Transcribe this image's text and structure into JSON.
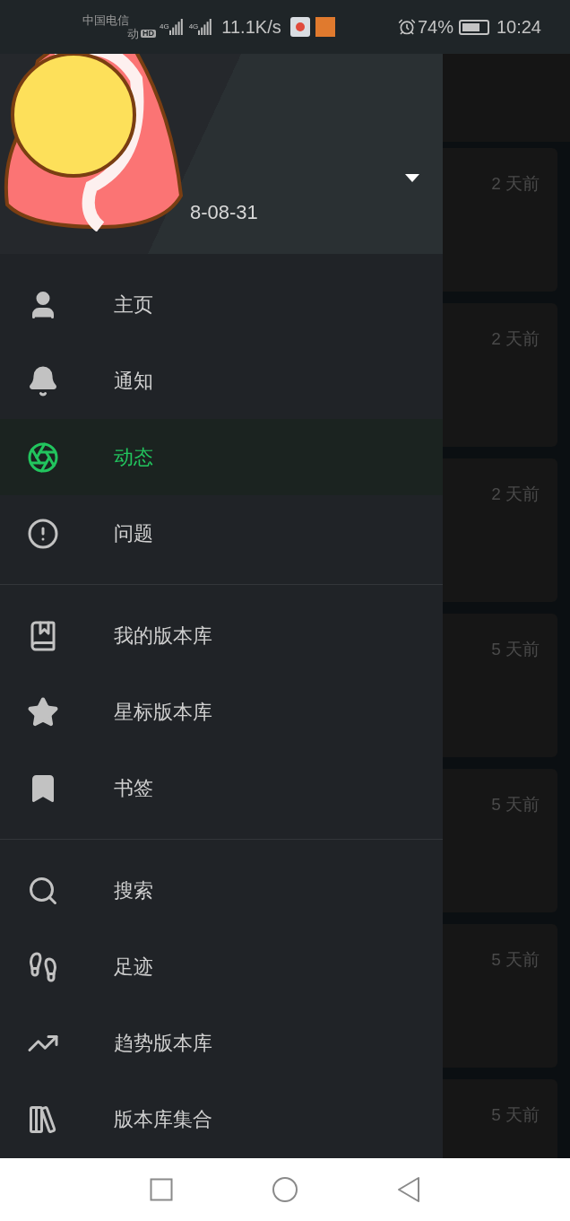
{
  "status_bar": {
    "carrier": "中国电信",
    "carrier_2": "动",
    "hd": "HD",
    "net_1": "4G",
    "net_2": "4G",
    "speed": "11.1K/s",
    "battery": "74%",
    "time": "10:24"
  },
  "drawer": {
    "header": {
      "joined": "8-08-31"
    },
    "groups": [
      [
        {
          "label": "主页",
          "kind": "person",
          "selected": false
        },
        {
          "label": "通知",
          "kind": "bell",
          "selected": false
        },
        {
          "label": "动态",
          "kind": "aperture",
          "selected": true
        },
        {
          "label": "问题",
          "kind": "alert",
          "selected": false
        }
      ],
      [
        {
          "label": "我的版本库",
          "kind": "book",
          "selected": false
        },
        {
          "label": "星标版本库",
          "kind": "star",
          "selected": false
        },
        {
          "label": "书签",
          "kind": "bookmark",
          "selected": false
        }
      ],
      [
        {
          "label": "搜索",
          "kind": "search",
          "selected": false
        },
        {
          "label": "足迹",
          "kind": "footprints",
          "selected": false
        },
        {
          "label": "趋势版本库",
          "kind": "trending",
          "selected": false
        },
        {
          "label": "版本库集合",
          "kind": "library",
          "selected": false
        }
      ]
    ]
  },
  "feed": [
    {
      "time": "2 天前"
    },
    {
      "time": "2 天前"
    },
    {
      "time": "2 天前"
    },
    {
      "time": "5 天前"
    },
    {
      "time": "5 天前"
    },
    {
      "time": "5 天前"
    },
    {
      "time": "5 天前"
    }
  ]
}
